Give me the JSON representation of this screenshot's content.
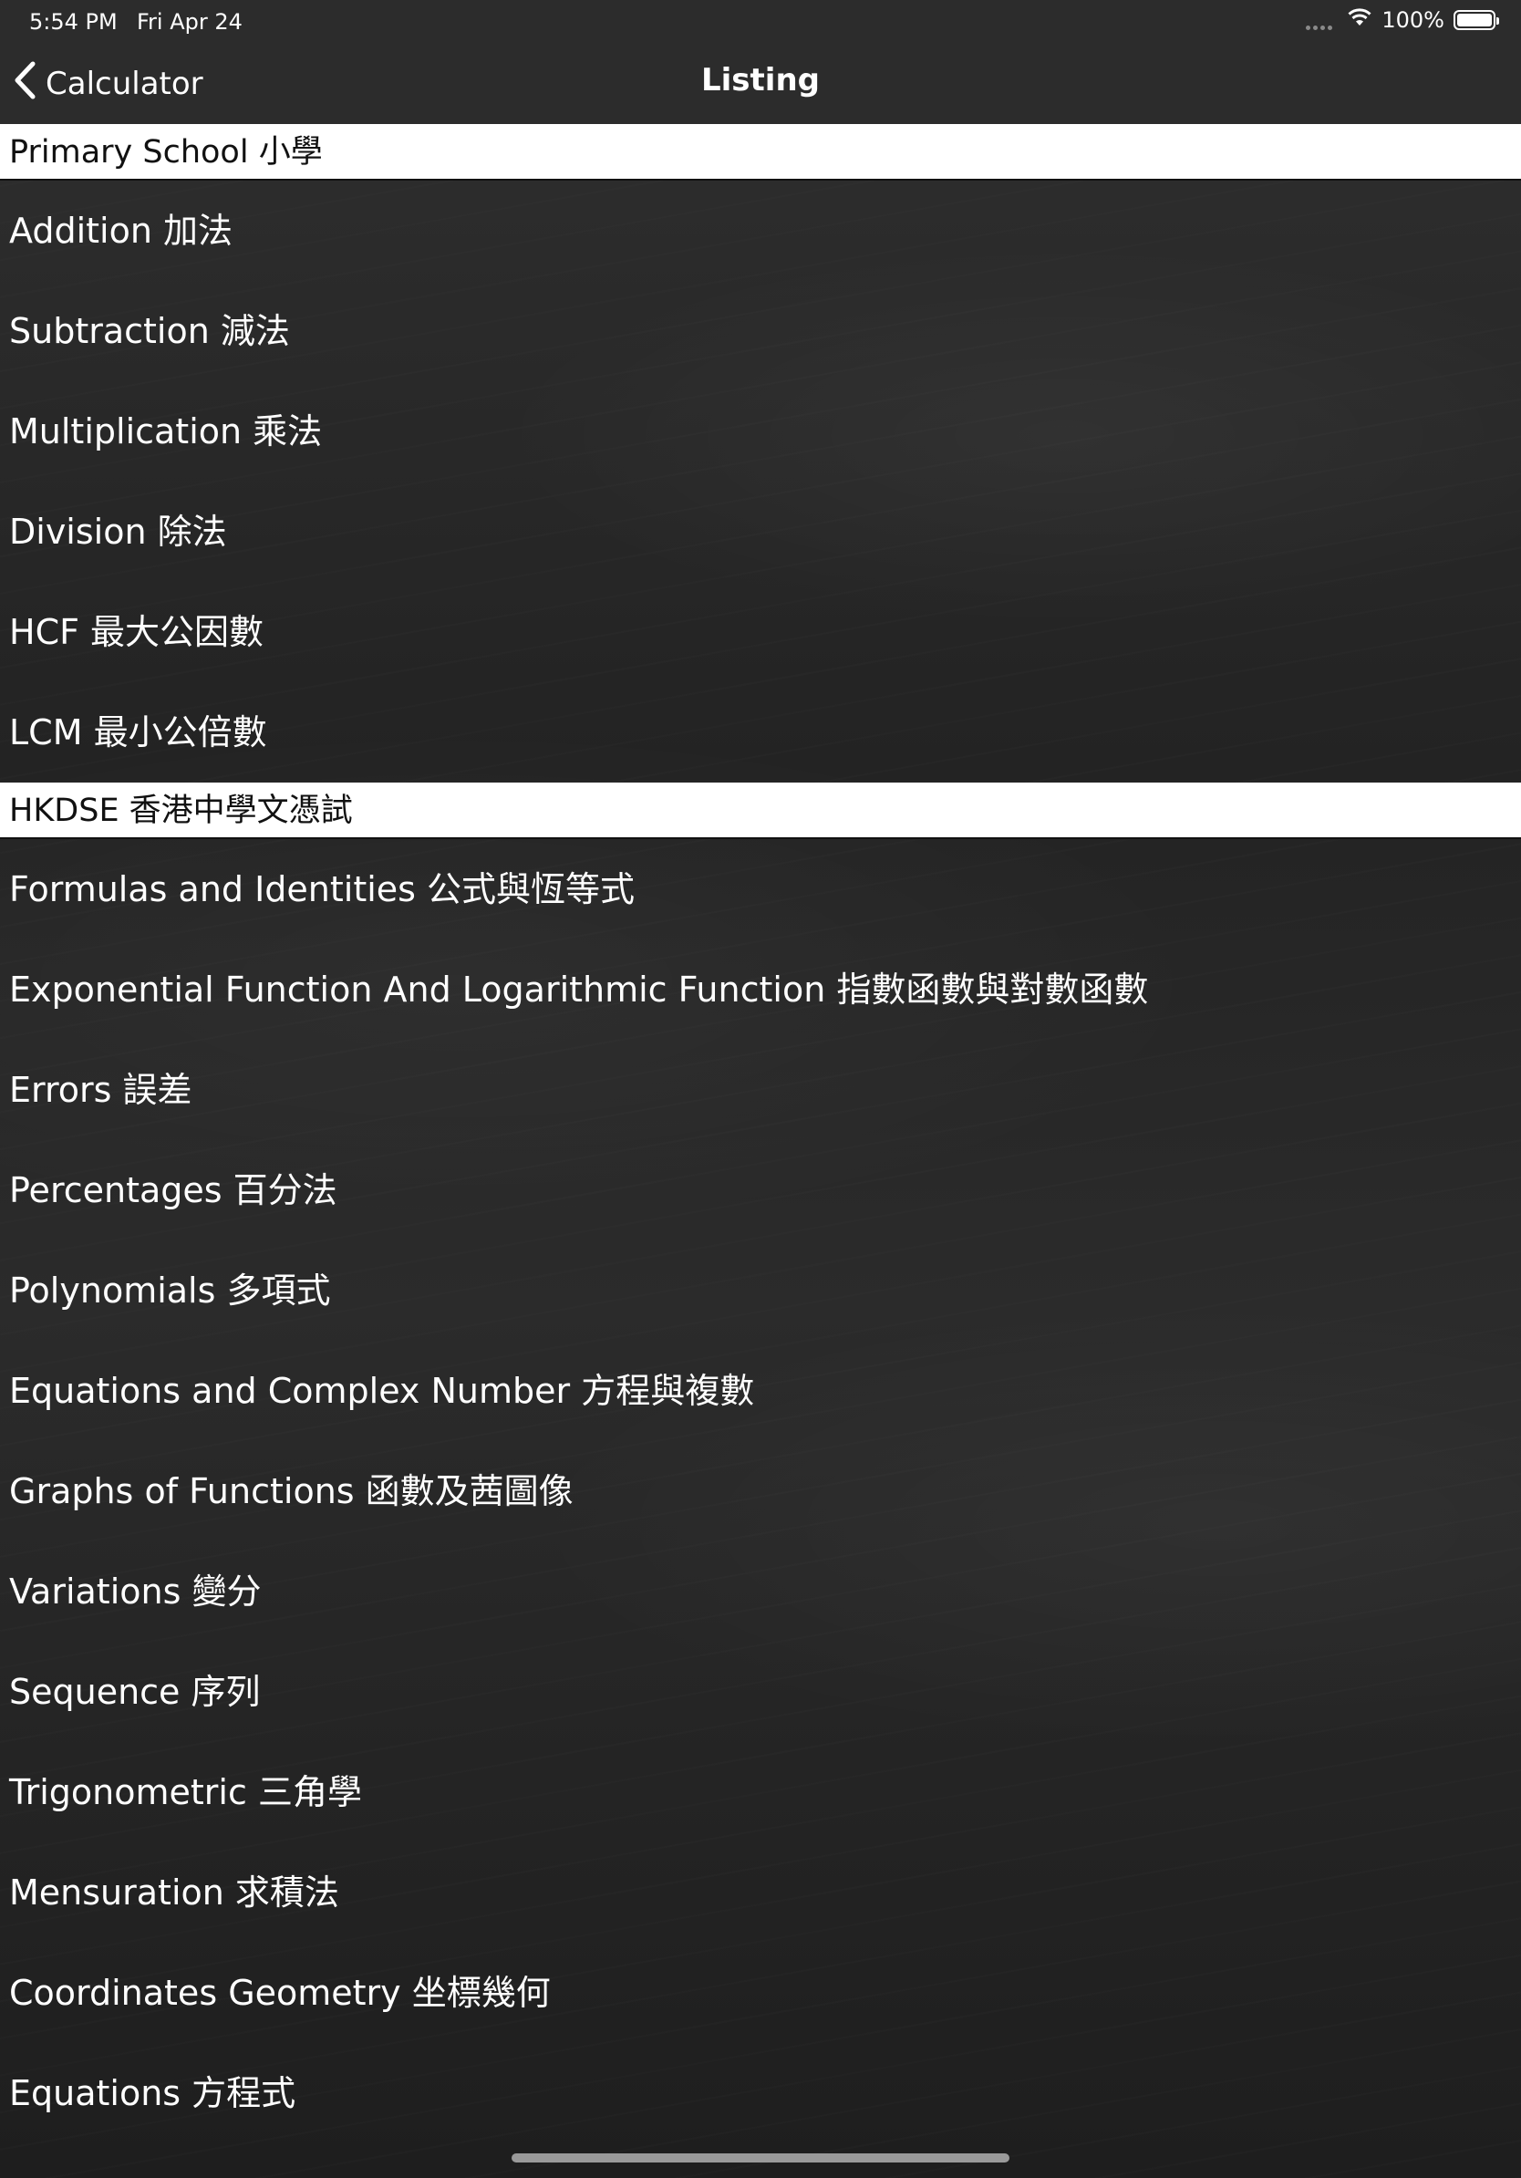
{
  "status_bar": {
    "time": "5:54 PM",
    "date": "Fri Apr 24",
    "battery_percent": "100%"
  },
  "nav": {
    "back_label": "Calculator",
    "title": "Listing"
  },
  "sections": [
    {
      "header": "Primary School 小學",
      "items": [
        "Addition 加法",
        "Subtraction 減法",
        "Multiplication 乘法",
        "Division 除法",
        "HCF 最大公因數",
        "LCM 最小公倍數"
      ]
    },
    {
      "header": "HKDSE 香港中學文憑試",
      "items": [
        "Formulas and Identities 公式與恆等式",
        "Exponential Function And Logarithmic Function 指數函數與對數函數",
        "Errors 誤差",
        "Percentages 百分法",
        "Polynomials 多項式",
        "Equations and Complex Number 方程與複數",
        "Graphs of Functions 函數及茜圖像",
        "Variations 變分",
        "Sequence 序列",
        "Trigonometric 三角學",
        "Mensuration 求積法",
        "Coordinates Geometry 坐標幾何",
        "Equations 方程式"
      ]
    }
  ],
  "colors": {
    "section_header_bg": "#ffffff",
    "section_header_text": "#111111",
    "row_text": "#ffffff",
    "bar_bg": "#2c2c2c"
  }
}
